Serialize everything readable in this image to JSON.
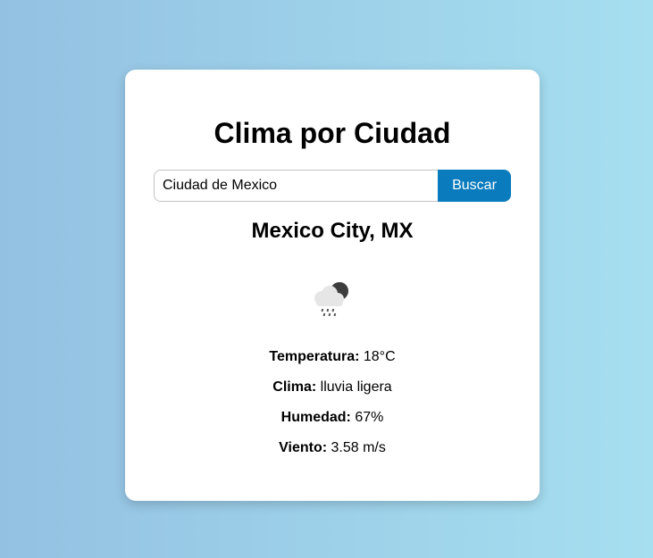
{
  "app": {
    "title": "Clima por Ciudad"
  },
  "search": {
    "value": "Ciudad de Mexico",
    "button_label": "Buscar"
  },
  "result": {
    "city": "Mexico City, MX",
    "icon": "rain-cloud-night-icon",
    "details": [
      {
        "label": "Temperatura:",
        "value": "18°C"
      },
      {
        "label": "Clima:",
        "value": "lluvia ligera"
      },
      {
        "label": "Humedad:",
        "value": "67%"
      },
      {
        "label": "Viento:",
        "value": "3.58 m/s"
      }
    ]
  },
  "colors": {
    "background_start": "#93c1e2",
    "background_end": "#a6dff0",
    "button": "#0a7bbd",
    "card": "#ffffff"
  }
}
